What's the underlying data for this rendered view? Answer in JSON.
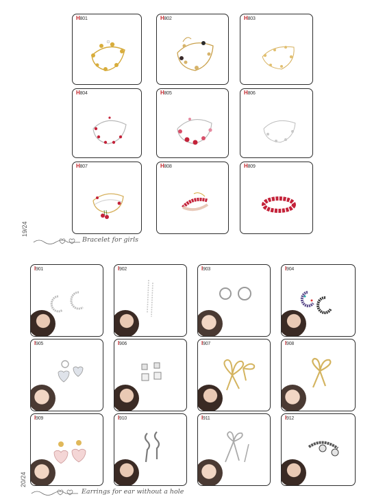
{
  "bracelets": {
    "page_number": "19/24",
    "title": "Bracelet for girls",
    "items": [
      {
        "pfx": "H",
        "num": "801"
      },
      {
        "pfx": "H",
        "num": "802"
      },
      {
        "pfx": "H",
        "num": "803"
      },
      {
        "pfx": "H",
        "num": "804"
      },
      {
        "pfx": "H",
        "num": "805"
      },
      {
        "pfx": "H",
        "num": "806"
      },
      {
        "pfx": "H",
        "num": "807"
      },
      {
        "pfx": "H",
        "num": "808"
      },
      {
        "pfx": "H",
        "num": "809"
      }
    ]
  },
  "earrings": {
    "page_number": "20/24",
    "title": "Earrings for ear without a hole",
    "items": [
      {
        "pfx": "I",
        "num": "901"
      },
      {
        "pfx": "I",
        "num": "902"
      },
      {
        "pfx": "I",
        "num": "903"
      },
      {
        "pfx": "I",
        "num": "904"
      },
      {
        "pfx": "I",
        "num": "905"
      },
      {
        "pfx": "I",
        "num": "906"
      },
      {
        "pfx": "I",
        "num": "907"
      },
      {
        "pfx": "I",
        "num": "908"
      },
      {
        "pfx": "I",
        "num": "909"
      },
      {
        "pfx": "I",
        "num": "910"
      },
      {
        "pfx": "I",
        "num": "911"
      },
      {
        "pfx": "I",
        "num": "912"
      }
    ]
  },
  "colors": {
    "code_prefix": "#c0262b",
    "gold": "#d4a93a",
    "silver": "#b8b8b8",
    "red": "#c4233a",
    "border": "#2b2b2b"
  }
}
